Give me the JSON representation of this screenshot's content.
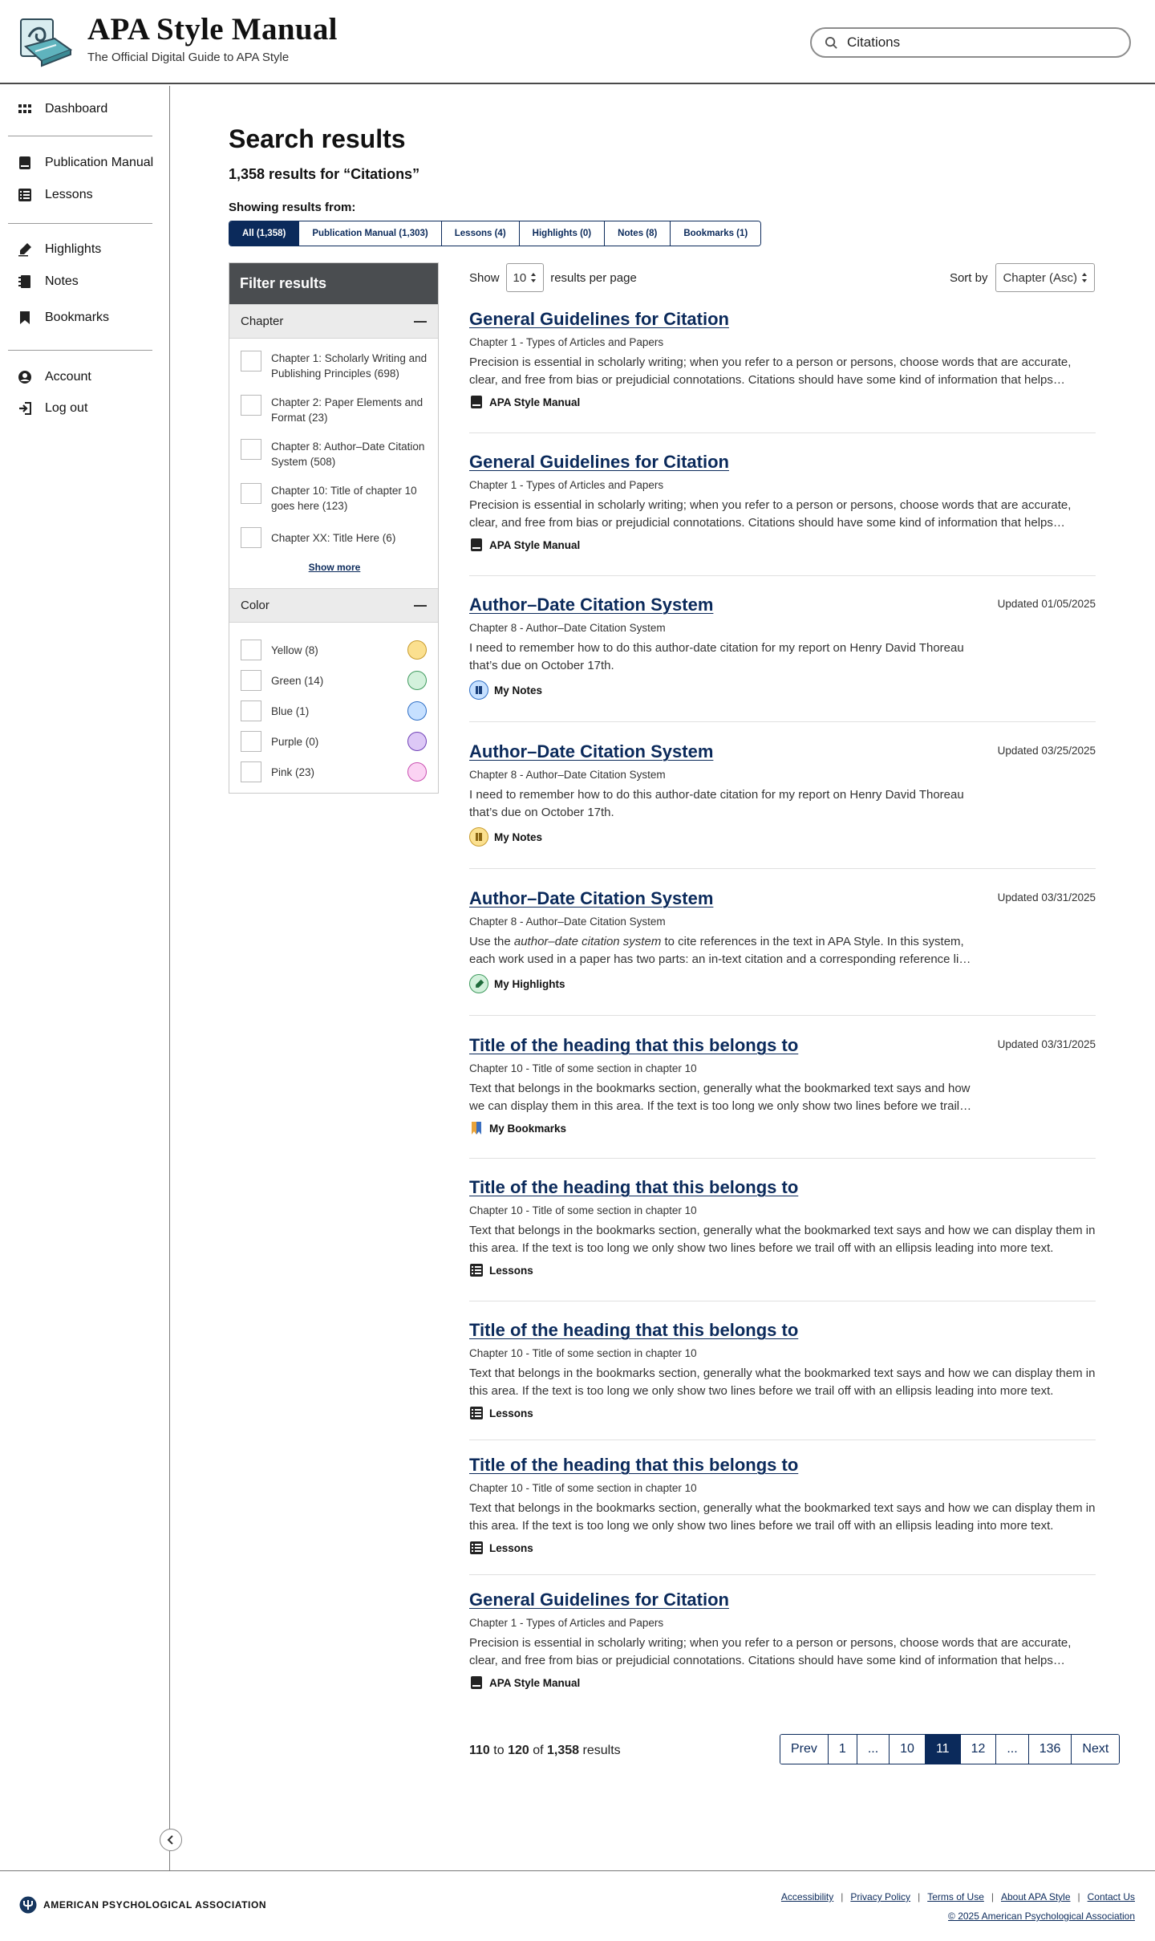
{
  "header": {
    "title": "APA Style Manual",
    "subtitle": "The Official Digital Guide to APA Style",
    "search_value": "Citations"
  },
  "sidebar": {
    "items": [
      {
        "label": "Dashboard",
        "icon": "grid-icon"
      },
      {
        "label": "Publication Manual",
        "icon": "book-icon"
      },
      {
        "label": "Lessons",
        "icon": "list-icon"
      },
      {
        "label": "Highlights",
        "icon": "highlighter-icon"
      },
      {
        "label": "Notes",
        "icon": "notebook-icon"
      },
      {
        "label": "Bookmarks",
        "icon": "bookmark-icon"
      },
      {
        "label": "Account",
        "icon": "user-icon"
      },
      {
        "label": "Log out",
        "icon": "logout-icon"
      }
    ]
  },
  "main": {
    "title": "Search results",
    "count_text": "1,358 results for “Citations”",
    "showing_label": "Showing results from:",
    "tabs": [
      {
        "label": "All (1,358)",
        "active": true
      },
      {
        "label": "Publication Manual (1,303)",
        "active": false
      },
      {
        "label": "Lessons (4)",
        "active": false
      },
      {
        "label": "Highlights (0)",
        "active": false
      },
      {
        "label": "Notes (8)",
        "active": false
      },
      {
        "label": "Bookmarks (1)",
        "active": false
      }
    ],
    "filter": {
      "title": "Filter results",
      "chapter_label": "Chapter",
      "chapters": [
        "Chapter 1: Scholarly Writing and Publishing Principles (698)",
        "Chapter 2: Paper Elements and Format (23)",
        "Chapter 8: Author–Date Citation System (508)",
        "Chapter 10: Title of chapter 10 goes here (123)",
        "Chapter XX: Title Here (6)"
      ],
      "show_more": "Show more",
      "color_label": "Color",
      "colors": [
        {
          "label": "Yellow (8)",
          "color": "#fbe08f",
          "border": "#c89b2c"
        },
        {
          "label": "Green (14)",
          "color": "#d3f1dc",
          "border": "#3f9a5e"
        },
        {
          "label": "Blue (1)",
          "color": "#c6e0ff",
          "border": "#2f6fc6"
        },
        {
          "label": "Purple (0)",
          "color": "#ddc8f6",
          "border": "#6e3fb6"
        },
        {
          "label": "Pink (23)",
          "color": "#fbd3f3",
          "border": "#c94fb0"
        }
      ]
    },
    "controls": {
      "show_label": "Show",
      "per_page": "10",
      "per_page_suffix": "results per page",
      "sort_label": "Sort by",
      "sort_value": "Chapter (Asc)"
    },
    "results": [
      {
        "title": "General Guidelines for Citation",
        "chapter": "Chapter 1 - Types of Articles and Papers",
        "text": "Precision is essential in scholarly writing; when you refer to a person or persons, choose words that are accurate, clear, and free from bias or prejudicial connotations. Citations should have some kind of information that helps readers locate the source.",
        "source": "APA Style Manual",
        "source_icon": "book-icon",
        "updated": ""
      },
      {
        "title": "General Guidelines for Citation",
        "chapter": "Chapter 1 - Types of Articles and Papers",
        "text": "Precision is essential in scholarly writing; when you refer to a person or persons, choose words that are accurate, clear, and free from bias or prejudicial connotations. Citations should have some kind of information that helps readers locate the source.",
        "source": "APA Style Manual",
        "source_icon": "book-icon",
        "updated": ""
      },
      {
        "title": "Author–Date Citation System",
        "chapter": "Chapter 8 - Author–Date Citation System",
        "text": "I need to remember how to do this author-date citation for my report on Henry David Thoreau that’s due on October 17th.",
        "source": "My Notes",
        "source_icon": "note-blue-icon",
        "updated": "Updated 01/05/2025"
      },
      {
        "title": "Author–Date Citation System",
        "chapter": "Chapter 8 - Author–Date Citation System",
        "text": "I need to remember how to do this author-date citation for my report on Henry David Thoreau that’s due on October 17th.",
        "source": "My Notes",
        "source_icon": "note-yellow-icon",
        "updated": "Updated 03/25/2025"
      },
      {
        "title": "Author–Date Citation System",
        "chapter": "Chapter 8 - Author–Date Citation System",
        "text_pre": "Use the ",
        "text_em": "author–date citation system",
        "text_post": " to cite references in the text in APA Style. In this system, each work used in a paper has two parts: an in-text citation and a corresponding reference list entry.",
        "source": "My Highlights",
        "source_icon": "highlight-green-icon",
        "updated": "Updated 03/31/2025"
      },
      {
        "title": "Title of the heading that this belongs to",
        "chapter": "Chapter 10 - Title of some section in chapter 10",
        "text": "Text that belongs in the bookmarks section, generally what the bookmarked text says and how we can display them in this area. If the text is too long we only show two lines before we trail off.",
        "source": "My Bookmarks",
        "source_icon": "bookmark-color-icon",
        "updated": "Updated 03/31/2025"
      },
      {
        "title": "Title of the heading that this belongs to",
        "chapter": "Chapter 10 - Title of some section in chapter 10",
        "text": "Text that belongs in the bookmarks section, generally what the bookmarked text says and how we can display them in this area. If the text is too long we only show two lines before we trail off with an ellipsis leading into more text.",
        "source": "Lessons",
        "source_icon": "list-icon",
        "updated": ""
      },
      {
        "title": "Title of the heading that this belongs to",
        "chapter": "Chapter 10 - Title of some section in chapter 10",
        "text": "Text that belongs in the bookmarks section, generally what the bookmarked text says and how we can display them in this area. If the text is too long we only show two lines before we trail off with an ellipsis leading into more text.",
        "source": "Lessons",
        "source_icon": "list-icon",
        "updated": ""
      },
      {
        "title": "Title of the heading that this belongs to",
        "chapter": "Chapter 10 - Title of some section in chapter 10",
        "text": "Text that belongs in the bookmarks section, generally what the bookmarked text says and how we can display them in this area. If the text is too long we only show two lines before we trail off with an ellipsis leading into more text.",
        "source": "Lessons",
        "source_icon": "list-icon",
        "updated": ""
      },
      {
        "title": "General Guidelines for Citation",
        "chapter": "Chapter 1 - Types of Articles and Papers",
        "text": "Precision is essential in scholarly writing; when you refer to a person or persons, choose words that are accurate, clear, and free from bias or prejudicial connotations. Citations should have some kind of information that helps readers locate the source.",
        "source": "APA Style Manual",
        "source_icon": "book-icon",
        "updated": ""
      }
    ],
    "pagination": {
      "from": "110",
      "to_word": "to",
      "to": "120",
      "of_word": "of",
      "total": "1,358",
      "results_word": "results",
      "pages": [
        "Prev",
        "1",
        "...",
        "10",
        "11",
        "12",
        "...",
        "136",
        "Next"
      ],
      "active": "11"
    }
  },
  "footer": {
    "org": "AMERICAN PSYCHOLOGICAL ASSOCIATION",
    "links": [
      "Accessibility",
      "Privacy Policy",
      "Terms of Use",
      "About APA Style",
      "Contact Us"
    ],
    "copyright": "© 2025 American Psychological Association"
  },
  "colors": {
    "navy": "#0b2a5b",
    "filter_header": "#4a4d50"
  }
}
